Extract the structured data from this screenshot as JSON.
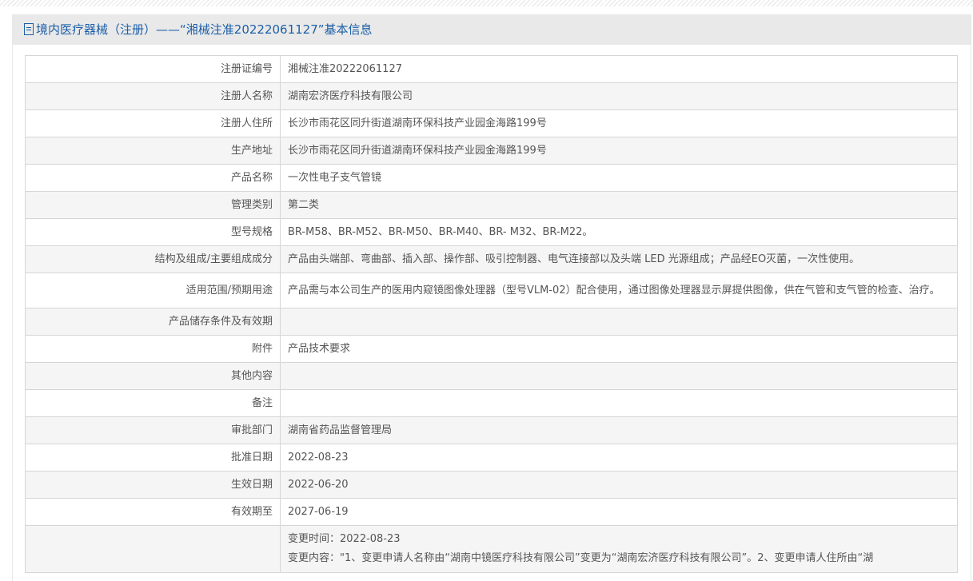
{
  "title": "境内医疗器械（注册）——“湘械注准20222061127”基本信息",
  "rows": [
    {
      "label": "注册证编号",
      "value": "湘械注准20222061127"
    },
    {
      "label": "注册人名称",
      "value": "湖南宏济医疗科技有限公司"
    },
    {
      "label": "注册人住所",
      "value": "长沙市雨花区同升街道湖南环保科技产业园金海路199号"
    },
    {
      "label": "生产地址",
      "value": "长沙市雨花区同升街道湖南环保科技产业园金海路199号"
    },
    {
      "label": "产品名称",
      "value": "一次性电子支气管镜"
    },
    {
      "label": "管理类别",
      "value": "第二类"
    },
    {
      "label": "型号规格",
      "value": "BR-M58、BR-M52、BR-M50、BR-M40、BR- M32、BR-M22。"
    },
    {
      "label": "结构及组成/主要组成成分",
      "value": "产品由头端部、弯曲部、插入部、操作部、吸引控制器、电气连接部以及头端 LED 光源组成；产品经EO灭菌，一次性使用。"
    },
    {
      "label": "适用范围/预期用途",
      "value": "产品需与本公司生产的医用内窥镜图像处理器（型号VLM-02）配合使用，通过图像处理器显示屏提供图像，供在气管和支气管的检查、治疗。"
    },
    {
      "label": "产品储存条件及有效期",
      "value": ""
    },
    {
      "label": "附件",
      "value": "产品技术要求"
    },
    {
      "label": "其他内容",
      "value": ""
    },
    {
      "label": "备注",
      "value": ""
    },
    {
      "label": "审批部门",
      "value": "湖南省药品监督管理局"
    },
    {
      "label": "批准日期",
      "value": "2022-08-23"
    },
    {
      "label": "生效日期",
      "value": "2022-06-20"
    },
    {
      "label": "有效期至",
      "value": "2027-06-19"
    }
  ],
  "change": {
    "time": "变更时间：2022-08-23",
    "content": "变更内容：\"1、变更申请人名称由“湖南中镜医疗科技有限公司”变更为“湖南宏济医疗科技有限公司”。2、变更申请人住所由“湖"
  }
}
